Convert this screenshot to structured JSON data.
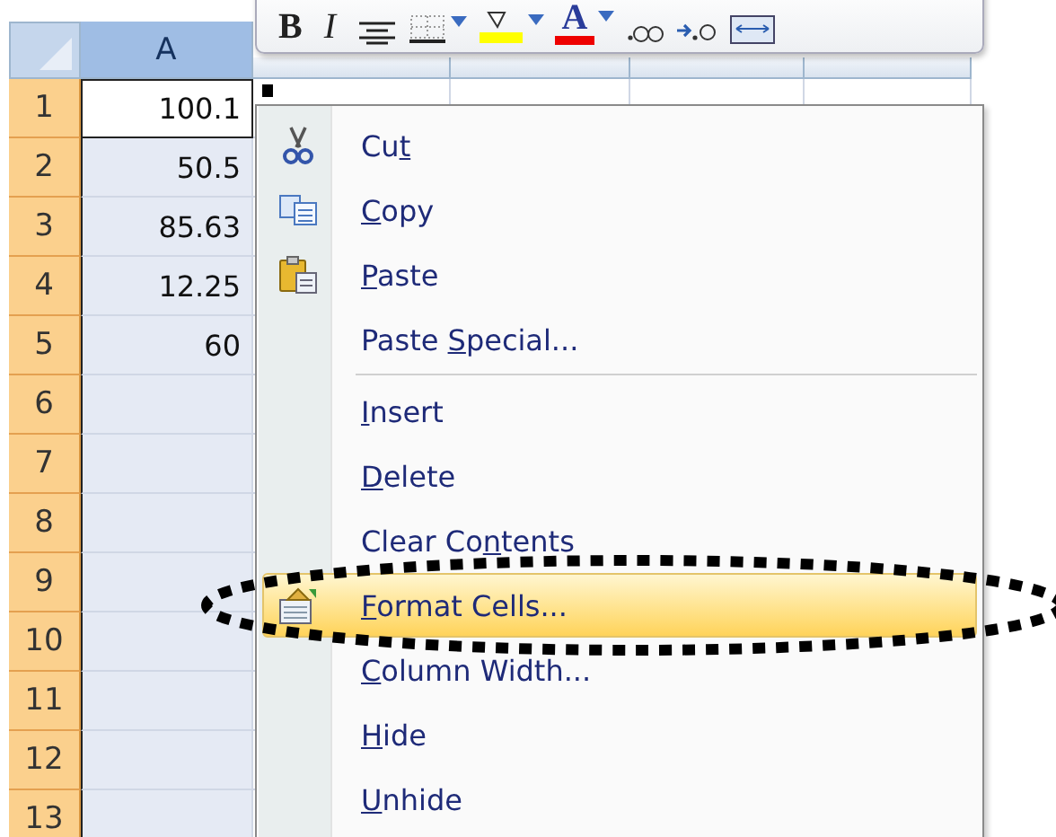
{
  "toolbar": {
    "buttons": [
      {
        "kind": "bold",
        "label": "B"
      },
      {
        "kind": "italic",
        "label": "I"
      },
      {
        "kind": "align"
      },
      {
        "kind": "borders"
      },
      {
        "kind": "fill"
      },
      {
        "kind": "font_color",
        "label": "A"
      },
      {
        "kind": "increase_decimal"
      },
      {
        "kind": "decrease_decimal"
      },
      {
        "kind": "merge"
      }
    ]
  },
  "sheet": {
    "columns": [
      {
        "label": "A",
        "selected": true
      },
      {
        "selected": false
      },
      {
        "selected": false
      },
      {
        "selected": false
      },
      {
        "selected": false
      }
    ],
    "rows": [
      {
        "number": "1",
        "selected": true,
        "active": true,
        "value": "100.1"
      },
      {
        "number": "2",
        "selected": true,
        "active": false,
        "value": "50.5"
      },
      {
        "number": "3",
        "selected": true,
        "active": false,
        "value": "85.63"
      },
      {
        "number": "4",
        "selected": true,
        "active": false,
        "value": "12.25"
      },
      {
        "number": "5",
        "selected": true,
        "active": false,
        "value": "60"
      },
      {
        "number": "6",
        "selected": true,
        "active": false
      },
      {
        "number": "7",
        "selected": true,
        "active": false
      },
      {
        "number": "8",
        "selected": true,
        "active": false
      },
      {
        "number": "9",
        "selected": true,
        "active": false
      },
      {
        "number": "10",
        "selected": true,
        "active": false
      },
      {
        "number": "11",
        "selected": true,
        "active": false
      },
      {
        "number": "12",
        "selected": true,
        "active": false
      },
      {
        "number": "13",
        "selected": true,
        "active": false
      }
    ]
  },
  "context_menu": {
    "items": [
      {
        "kind": "cut",
        "pre": "Cu",
        "key": "t",
        "selected": false
      },
      {
        "kind": "copy",
        "key": "C",
        "post": "opy",
        "selected": false
      },
      {
        "kind": "paste",
        "key": "P",
        "post": "aste",
        "selected": false
      },
      {
        "kind": "item",
        "pre": "Paste ",
        "key": "S",
        "post": "pecial...",
        "selected": false
      },
      {
        "kind": "separator"
      },
      {
        "kind": "item",
        "key": "I",
        "post": "nsert",
        "selected": false
      },
      {
        "kind": "item",
        "key": "D",
        "post": "elete",
        "selected": false
      },
      {
        "kind": "item",
        "pre": "Clear Co",
        "key": "n",
        "post": "tents",
        "selected": false
      },
      {
        "kind": "format",
        "key": "F",
        "post": "ormat Cells...",
        "selected": true
      },
      {
        "kind": "item",
        "key": "C",
        "post": "olumn Width...",
        "selected": false
      },
      {
        "kind": "item",
        "key": "H",
        "post": "ide",
        "selected": false
      },
      {
        "kind": "item",
        "key": "U",
        "post": "nhide",
        "selected": false
      }
    ]
  }
}
